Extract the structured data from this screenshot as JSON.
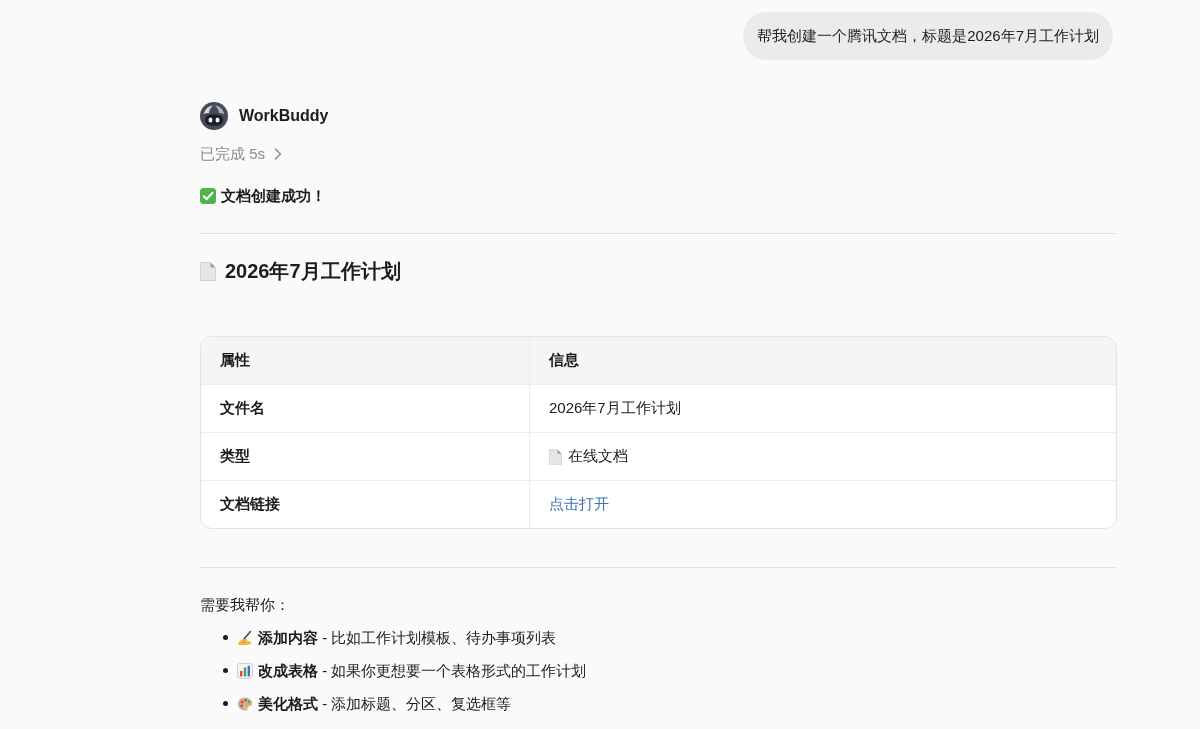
{
  "user_message": {
    "text": "帮我创建一个腾讯文档，标题是2026年7月工作计划"
  },
  "assistant": {
    "name": "WorkBuddy",
    "status": {
      "text": "已完成 5s",
      "expanded": false
    },
    "success_message": "文档创建成功！",
    "document_title": "2026年7月工作计划",
    "table": {
      "columns": [
        "属性",
        "信息"
      ],
      "rows": [
        {
          "kind": "text",
          "label": "文件名",
          "value": "2026年7月工作计划"
        },
        {
          "kind": "doc-type",
          "label": "类型",
          "value": "在线文档"
        },
        {
          "kind": "link",
          "label": "文档链接",
          "value": "点击打开"
        }
      ]
    },
    "intro": "需要我帮你：",
    "suggestions": [
      {
        "kind": "write",
        "text": "**添加内容** - 比如工作计划模板、待办事项列表"
      },
      {
        "kind": "chart",
        "text": "**改成表格** - 如果你更想要一个表格形式的工作计划"
      },
      {
        "kind": "style",
        "text": "**美化格式** - 添加标题、分区、复选框等"
      }
    ]
  }
}
